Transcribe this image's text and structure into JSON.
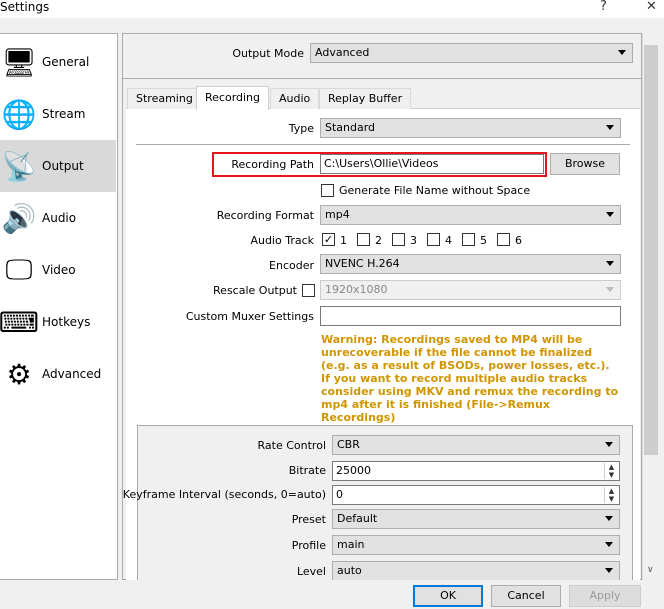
{
  "window": {
    "title": "Settings",
    "help": "?",
    "close": "✕"
  },
  "sidebar": {
    "items": [
      {
        "label": "General",
        "icon": "general-icon",
        "glyph": "🖥"
      },
      {
        "label": "Stream",
        "icon": "globe-icon",
        "glyph": "🌐"
      },
      {
        "label": "Output",
        "icon": "broadcast-icon",
        "glyph": "📡",
        "selected": true
      },
      {
        "label": "Audio",
        "icon": "speaker-icon",
        "glyph": "🔊"
      },
      {
        "label": "Video",
        "icon": "monitor-icon",
        "glyph": "🖵"
      },
      {
        "label": "Hotkeys",
        "icon": "keyboard-icon",
        "glyph": "⌨"
      },
      {
        "label": "Advanced",
        "icon": "gears-icon",
        "glyph": "⚙"
      }
    ]
  },
  "output_mode": {
    "label": "Output Mode",
    "value": "Advanced"
  },
  "tabs": [
    "Streaming",
    "Recording",
    "Audio",
    "Replay Buffer"
  ],
  "active_tab": "Recording",
  "recording": {
    "type_label": "Type",
    "type_value": "Standard",
    "path_label": "Recording Path",
    "path_value": "C:\\Users\\Ollie\\Videos",
    "browse": "Browse",
    "nospace_label": "Generate File Name without Space",
    "format_label": "Recording Format",
    "format_value": "mp4",
    "audio_track_label": "Audio Track",
    "tracks": [
      {
        "n": "1",
        "checked": true
      },
      {
        "n": "2"
      },
      {
        "n": "3"
      },
      {
        "n": "4"
      },
      {
        "n": "5"
      },
      {
        "n": "6"
      }
    ],
    "encoder_label": "Encoder",
    "encoder_value": "NVENC H.264",
    "rescale_label": "Rescale Output",
    "rescale_value": "1920x1080",
    "muxer_label": "Custom Muxer Settings",
    "muxer_value": "",
    "warning": "Warning: Recordings saved to MP4 will be unrecoverable if the file cannot be finalized (e.g. as a result of BSODs, power losses, etc.). If you want to record multiple audio tracks consider using MKV and remux the recording to mp4 after it is finished (File->Remux Recordings)",
    "warning_color": "#d09600",
    "highlight_color": "#e8141e"
  },
  "encoder_settings": {
    "rate_control_label": "Rate Control",
    "rate_control": "CBR",
    "bitrate_label": "Bitrate",
    "bitrate": "25000",
    "keyframe_label": "Keyframe Interval (seconds, 0=auto)",
    "keyframe": "0",
    "preset_label": "Preset",
    "preset": "Default",
    "profile_label": "Profile",
    "profile": "main",
    "level_label": "Level",
    "level": "auto"
  },
  "buttons": {
    "ok": "OK",
    "cancel": "Cancel",
    "apply": "Apply"
  }
}
